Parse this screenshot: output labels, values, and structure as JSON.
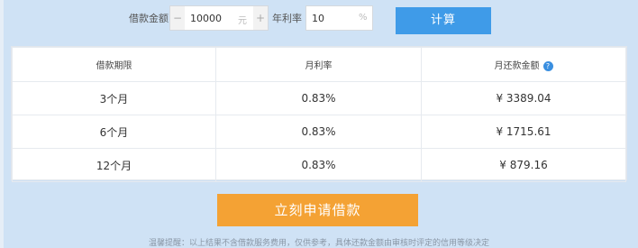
{
  "form": {
    "amount_label": "借款金额",
    "amount_minus": "−",
    "amount_value": "10000",
    "amount_unit": "元",
    "amount_plus": "+",
    "rate_label": "年利率",
    "rate_value": "10",
    "rate_unit": "%",
    "calc_button": "计算"
  },
  "table": {
    "headers": [
      "借款期限",
      "月利率",
      "月还款金额"
    ],
    "help_icon": "?",
    "rows": [
      {
        "term": "3个月",
        "rate": "0.83%",
        "payment": "¥ 3389.04"
      },
      {
        "term": "6个月",
        "rate": "0.83%",
        "payment": "¥ 1715.61"
      },
      {
        "term": "12个月",
        "rate": "0.83%",
        "payment": "¥ 879.16"
      }
    ]
  },
  "apply_button": "立刻申请借款",
  "tip": "温馨提醒：以上结果不含借款服务费用，仅供参考，具体还款金额由审核时评定的信用等级决定",
  "colors": {
    "background": "#cfe2f5",
    "calc_button": "#3f9be8",
    "apply_button": "#f4a234",
    "help_icon": "#3a8fe0"
  }
}
